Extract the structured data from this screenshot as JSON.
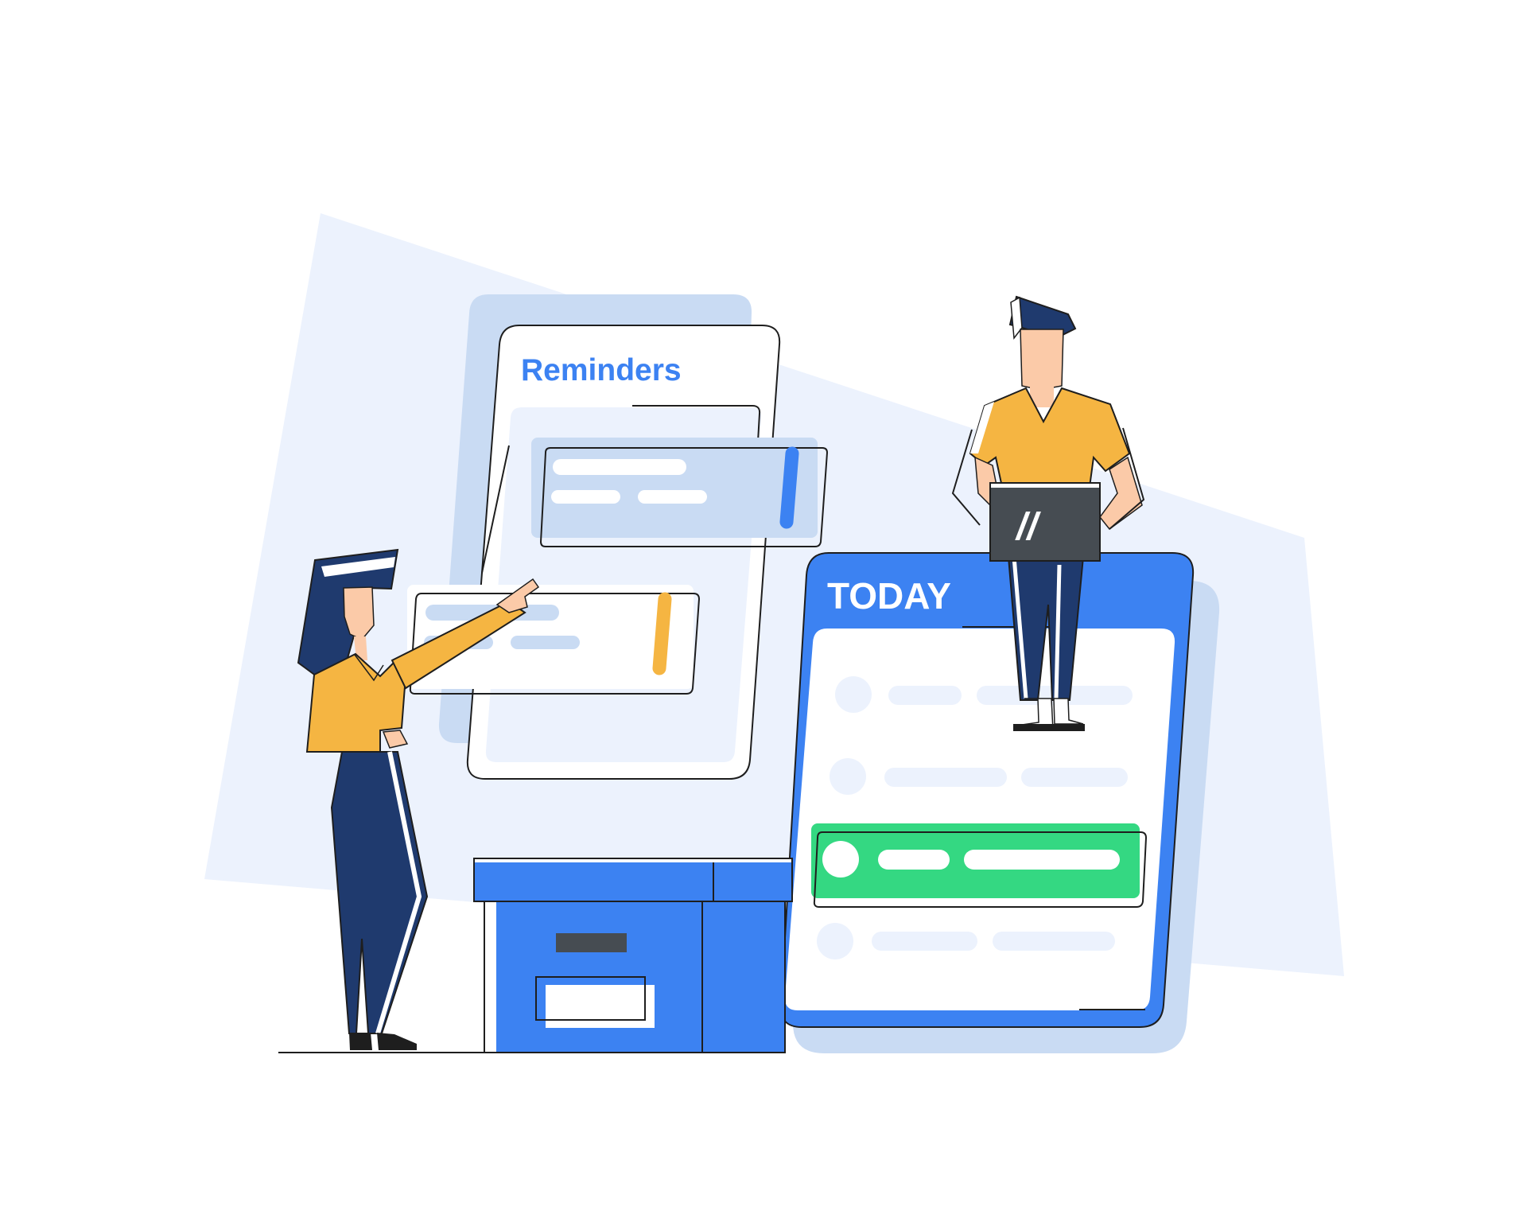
{
  "reminders_card": {
    "title": "Reminders"
  },
  "today_card": {
    "title": "TODAY"
  },
  "laptop": {
    "logo_text": "//"
  },
  "colors": {
    "background_shape": "#ecf2fd",
    "back_card": "#c9dbf3",
    "primary_blue": "#3c82f2",
    "navy": "#1f3a6e",
    "yellow": "#f5b542",
    "skin": "#fbcaa8",
    "green": "#34d882",
    "light_line": "#e2ebfb",
    "laptop_gray": "#464c52",
    "outline": "#1e1e1e"
  }
}
